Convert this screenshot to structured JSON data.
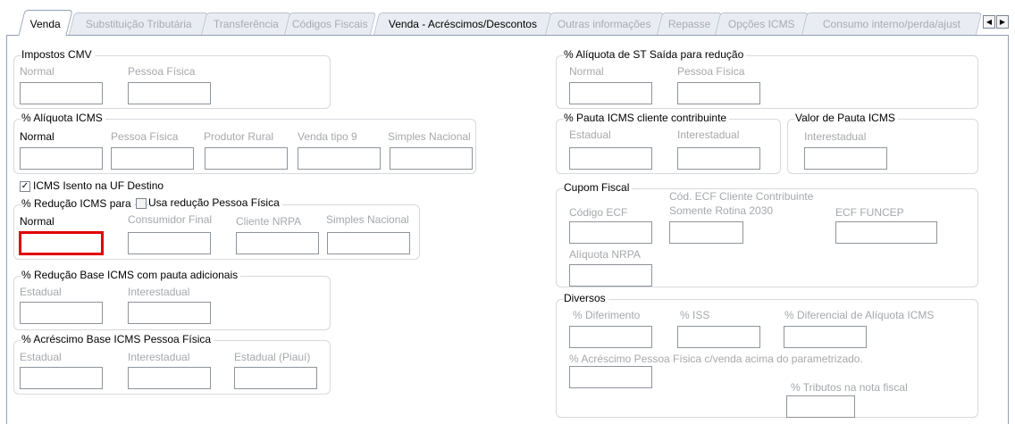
{
  "tabs": [
    {
      "label": "Venda",
      "state": "active"
    },
    {
      "label": "Substituição Tributária",
      "state": "inactive"
    },
    {
      "label": "Transferência",
      "state": "inactive"
    },
    {
      "label": "Códigos Fiscais",
      "state": "inactive"
    },
    {
      "label": "Venda - Acréscimos/Descontos",
      "state": "highlighted"
    },
    {
      "label": "Outras informações",
      "state": "inactive"
    },
    {
      "label": "Repasse",
      "state": "inactive"
    },
    {
      "label": "Opções ICMS",
      "state": "inactive"
    },
    {
      "label": "Consumo interno/perda/ajust",
      "state": "inactive"
    }
  ],
  "tab_scroll": {
    "left_icon": "chevron-left-icon",
    "left_glyph": "◀",
    "right_icon": "chevron-right-icon",
    "right_glyph": "▶"
  },
  "impostos_cmv": {
    "title": "Impostos CMV",
    "normal": "Normal",
    "pessoa_fisica": "Pessoa Física"
  },
  "aliquota_icms": {
    "title": "% Alíquota ICMS",
    "normal": "Normal",
    "pessoa_fisica": "Pessoa Física",
    "produtor_rural": "Produtor Rural",
    "venda_tipo9": "Venda tipo 9",
    "simples_nacional": "Simples Nacional"
  },
  "icms_isento": {
    "label": "ICMS Isento na UF Destino",
    "checked": true,
    "check_glyph": "✓"
  },
  "reducao_icms": {
    "title": "% Redução ICMS para",
    "usa_reducao_label": "Usa redução Pessoa Física",
    "usa_reducao_checked": false,
    "normal": "Normal",
    "consumidor_final": "Consumidor Final",
    "cliente_nrpa": "Cliente NRPA",
    "simples_nacional": "Simples Nacional"
  },
  "reducao_base_pauta": {
    "title": "% Redução Base ICMS com pauta adicionais",
    "estadual": "Estadual",
    "interestadual": "Interestadual"
  },
  "acrescimo_base_pf": {
    "title": "% Acréscimo Base ICMS Pessoa Física",
    "estadual": "Estadual",
    "interestadual": "Interestadual",
    "estadual_piaui": "Estadual (Piauí)"
  },
  "aliquota_st_saida": {
    "title": "% Alíquota de ST Saída para redução",
    "normal": "Normal",
    "pessoa_fisica": "Pessoa Física"
  },
  "pauta_icms_contribuinte": {
    "title": "% Pauta ICMS cliente contribuinte",
    "estadual": "Estadual",
    "interestadual": "Interestadual"
  },
  "valor_pauta_icms": {
    "title": "Valor de Pauta ICMS",
    "interestadual": "Interestadual"
  },
  "cupom_fiscal": {
    "title": "Cupom Fiscal",
    "codigo_ecf": "Código ECF",
    "cod_ecf_cliente_line1": "Cód. ECF Cliente Contribuinte",
    "cod_ecf_cliente_line2": "Somente Rotina 2030",
    "ecf_funcep": "ECF FUNCEP",
    "aliquota_nrpa": "Alíquota NRPA"
  },
  "diversos": {
    "title": "Diversos",
    "diferimento": "% Diferimento",
    "iss": "% ISS",
    "diferencial_aliquota": "% Diferencial de Alíquota ICMS",
    "acrescimo_pf": "% Acréscimo Pessoa Física c/venda acima do parametrizado.",
    "tributos_nota": "% Tributos na nota fiscal"
  }
}
